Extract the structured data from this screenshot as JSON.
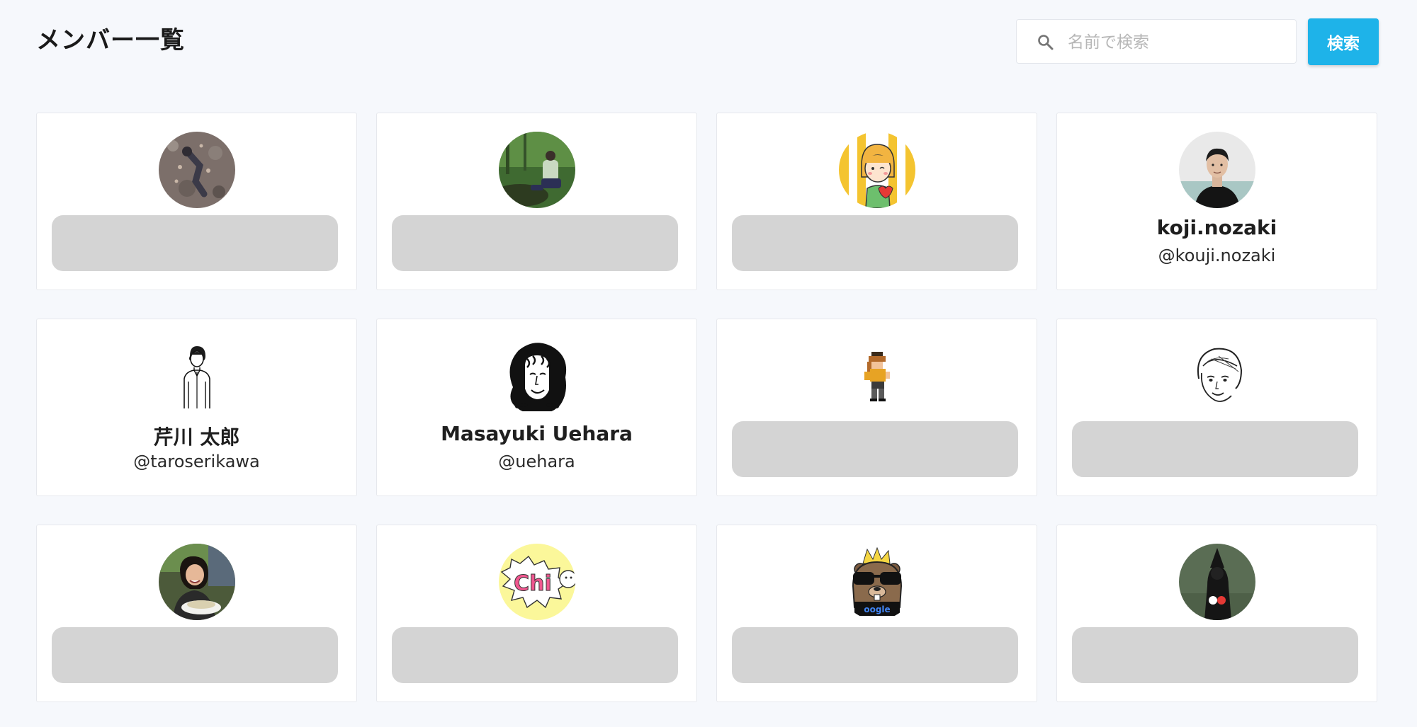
{
  "header": {
    "title": "メンバー一覧",
    "search_placeholder": "名前で検索",
    "search_button_label": "検索"
  },
  "members": [
    {
      "name": "",
      "handle": "",
      "loading": true,
      "avatar": "climbing-photo"
    },
    {
      "name": "",
      "handle": "",
      "loading": true,
      "avatar": "forest-photo"
    },
    {
      "name": "",
      "handle": "",
      "loading": true,
      "avatar": "girl-illustration"
    },
    {
      "name": "koji.nozaki",
      "handle": "@kouji.nozaki",
      "loading": false,
      "avatar": "portrait-photo"
    },
    {
      "name": "芹川 太郎",
      "handle": "@taroserikawa",
      "loading": false,
      "avatar": "line-drawing-person"
    },
    {
      "name": "Masayuki Uehara",
      "handle": "@uehara",
      "loading": false,
      "avatar": "curly-hair-drawing"
    },
    {
      "name": "",
      "handle": "",
      "loading": true,
      "avatar": "pixel-character"
    },
    {
      "name": "",
      "handle": "",
      "loading": true,
      "avatar": "sketch-face"
    },
    {
      "name": "",
      "handle": "",
      "loading": true,
      "avatar": "person-eating-photo"
    },
    {
      "name": "",
      "handle": "",
      "loading": true,
      "avatar": "chi-logo",
      "avatar_text": "Chi"
    },
    {
      "name": "",
      "handle": "",
      "loading": true,
      "avatar": "gopher-sunglasses",
      "avatar_text": "oogle"
    },
    {
      "name": "",
      "handle": "",
      "loading": true,
      "avatar": "dark-figure-photo"
    }
  ],
  "colors": {
    "background": "#f6f8fc",
    "accent": "#1eb3e9",
    "skeleton": "#d4d4d4"
  }
}
